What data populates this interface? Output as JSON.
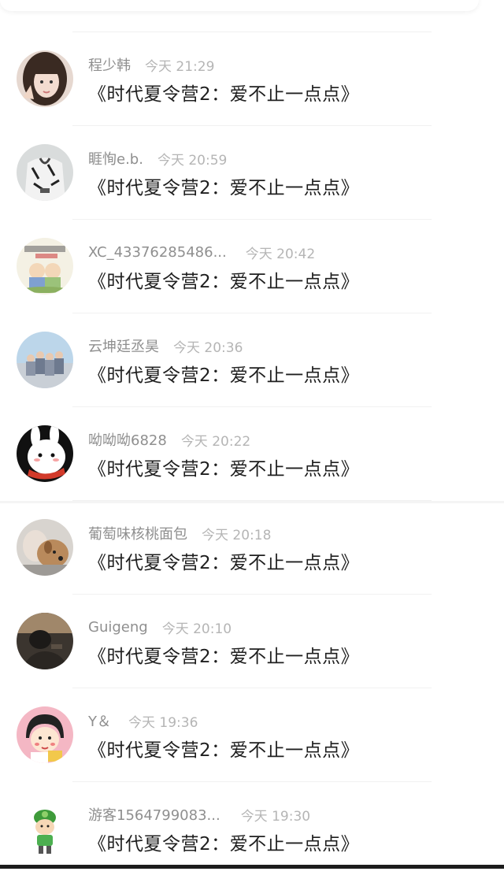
{
  "comments": [
    {
      "user": "程少韩",
      "time": "今天 21:29",
      "title": "《时代夏令营2：爱不止一点点》",
      "avatar": "girl-photo-avatar"
    },
    {
      "user": "睚恂e.b.",
      "time": "今天 20:59",
      "title": "《时代夏令营2：爱不止一点点》",
      "avatar": "graffiti-shirt-avatar"
    },
    {
      "user": "XC_43376285486...",
      "time": "今天 20:42",
      "title": "《时代夏令营2：爱不止一点点》",
      "avatar": "sticker-kids-avatar"
    },
    {
      "user": "云坤廷丞昊",
      "time": "今天 20:36",
      "title": "《时代夏令营2：爱不止一点点》",
      "avatar": "group-photo-avatar"
    },
    {
      "user": "呦呦呦6828",
      "time": "今天 20:22",
      "title": "《时代夏令营2：爱不止一点点》",
      "avatar": "cartoon-bunny-avatar"
    },
    {
      "user": "葡萄味核桃面包",
      "time": "今天 20:18",
      "title": "《时代夏令营2：爱不止一点点》",
      "avatar": "dog-photo-avatar"
    },
    {
      "user": "Guigeng",
      "time": "今天 20:10",
      "title": "《时代夏令营2：爱不止一点点》",
      "avatar": "dark-portrait-avatar"
    },
    {
      "user": "Y＆",
      "time": "今天 19:36",
      "title": "《时代夏令营2：爱不止一点点》",
      "avatar": "cartoon-girl-avatar"
    },
    {
      "user": "游客1564799083...",
      "time": "今天 19:30",
      "title": "《时代夏令营2：爱不止一点点》",
      "avatar": "green-hat-cartoon-avatar"
    }
  ],
  "colors": {
    "username": "#8f8f8f",
    "time": "#b5b5b5",
    "title": "#1f1f1f"
  }
}
